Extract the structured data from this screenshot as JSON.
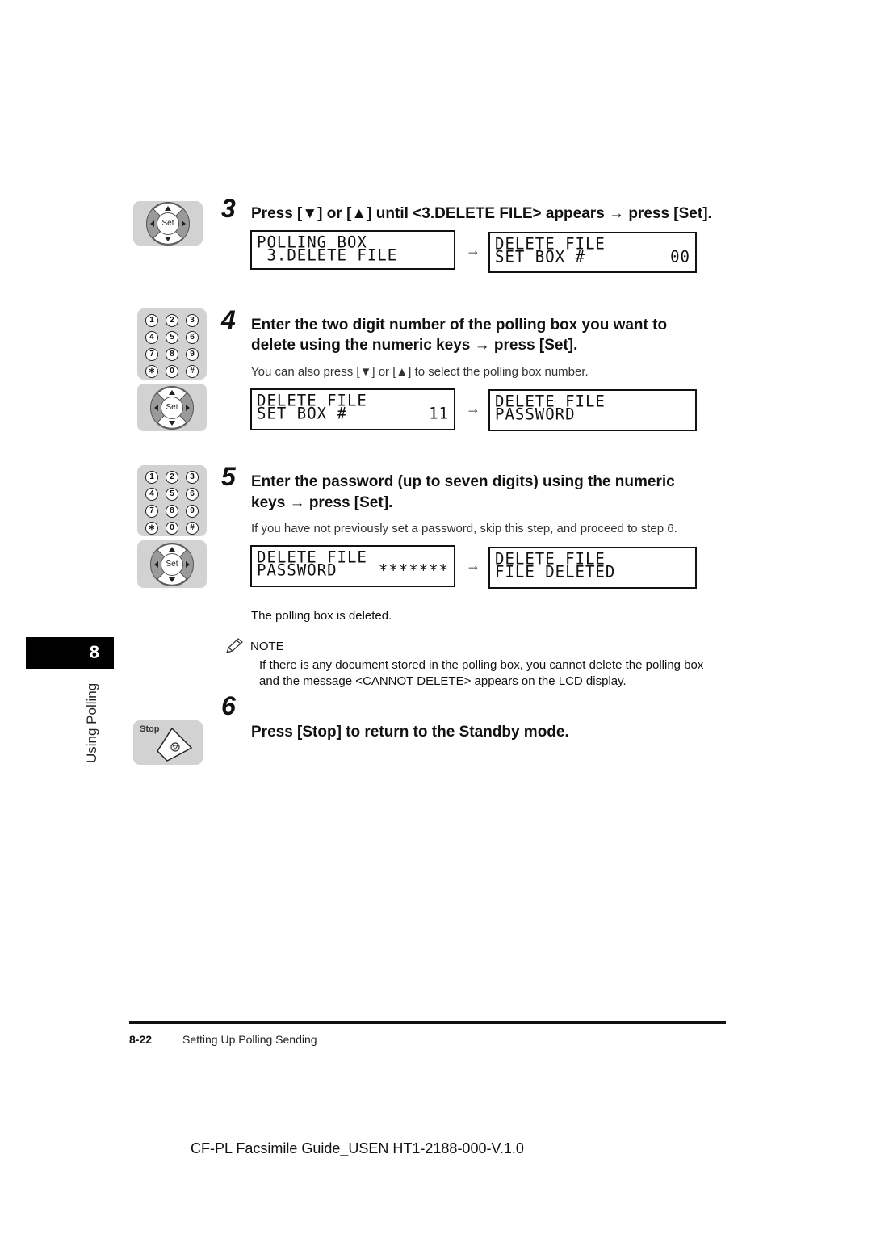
{
  "chapter": {
    "number": "8",
    "label": "Using Polling"
  },
  "steps": [
    {
      "number": "3",
      "title_lines": [
        "Press [▼] or [▲] until <3.DELETE FILE> appears → press [Set]."
      ],
      "note": "",
      "keys": [
        "set-dpad"
      ],
      "lcd_before": {
        "line1": "POLLING BOX",
        "line2": " 3.DELETE FILE",
        "line2_right": ""
      },
      "lcd_after": {
        "line1": "DELETE FILE",
        "line2": "SET BOX #",
        "line2_right": "00"
      }
    },
    {
      "number": "4",
      "title_lines": [
        "Enter the two digit number of the polling box you want to",
        "delete using the numeric keys → press [Set]."
      ],
      "note": "You can also press [▼] or [▲] to select the polling box number.",
      "keys": [
        "numeric-keypad",
        "set-dpad"
      ],
      "lcd_before": {
        "line1": "DELETE FILE",
        "line2": "SET BOX #",
        "line2_right": "11"
      },
      "lcd_after": {
        "line1": "DELETE FILE",
        "line2": "PASSWORD",
        "line2_right": ""
      }
    },
    {
      "number": "5",
      "title_lines": [
        "Enter the password (up to seven digits) using the numeric",
        "keys → press [Set]."
      ],
      "note": "If you have not previously set a password, skip this step, and proceed to step 6.",
      "keys": [
        "numeric-keypad",
        "set-dpad"
      ],
      "lcd_before": {
        "line1": "DELETE FILE",
        "line2": "PASSWORD",
        "line2_right": "*******"
      },
      "lcd_after": {
        "line1": "DELETE FILE",
        "line2": "FILE DELETED",
        "line2_right": ""
      }
    },
    {
      "number": "6",
      "title_lines": [
        "Press [Stop] to return to the Standby mode."
      ],
      "note": "",
      "keys": [
        "stop-key"
      ]
    }
  ],
  "result_text": "The polling box is deleted.",
  "note_block": {
    "heading": "NOTE",
    "icon": "pencil-icon",
    "lines": [
      "If there is any document stored in the polling box, you cannot delete the polling box",
      "and the message <CANNOT DELETE> appears on the LCD display."
    ]
  },
  "keypad": {
    "set_label": "Set",
    "stop_label": "Stop",
    "numeric_keys": [
      "1",
      "2",
      "3",
      "4",
      "5",
      "6",
      "7",
      "8",
      "9",
      "∗",
      "0",
      "#"
    ]
  },
  "arrow_glyph": "→",
  "footer": {
    "page_number": "8-22",
    "section": "Setting Up Polling Sending"
  },
  "document_id": "CF-PL Facsimile Guide_USEN HT1-2188-000-V.1.0"
}
